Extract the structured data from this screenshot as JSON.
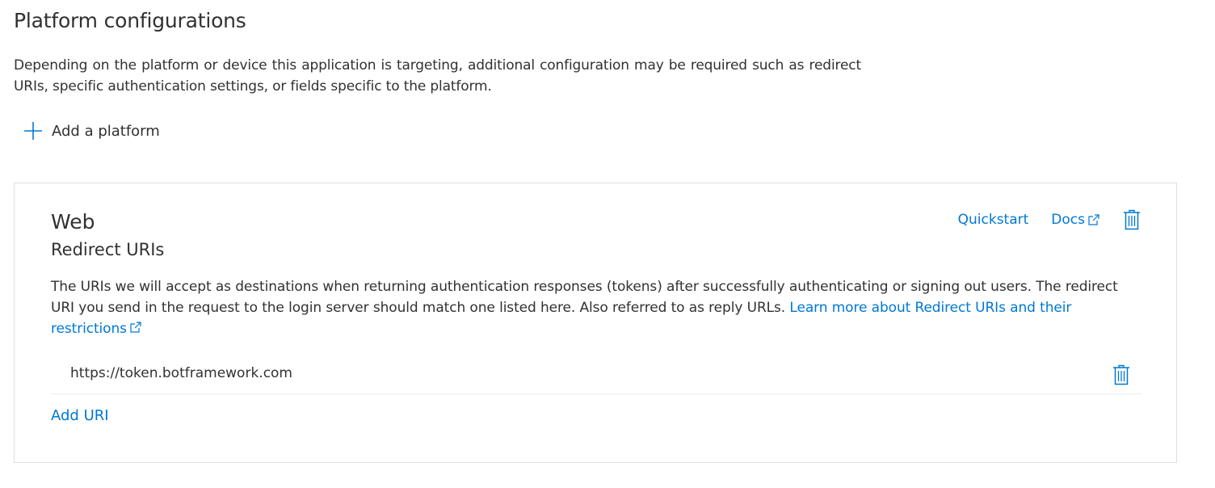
{
  "section": {
    "title": "Platform configurations",
    "description": "Depending on the platform or device this application is targeting, additional configuration may be required such as redirect URIs, specific authentication settings, or fields specific to the platform.",
    "add_platform_label": "Add a platform"
  },
  "card": {
    "title": "Web",
    "subtitle": "Redirect URIs",
    "actions": {
      "quickstart_label": "Quickstart",
      "docs_label": "Docs"
    },
    "description": "The URIs we will accept as destinations when returning authentication responses (tokens) after successfully authenticating or signing out users. The redirect URI you send in the request to the login server should match one listed here. Also referred to as reply URLs. ",
    "learn_more_label": "Learn more about Redirect URIs and their restrictions",
    "redirect_uris": [
      "https://token.botframework.com"
    ],
    "add_uri_label": "Add URI"
  },
  "icons": {
    "add": "plus-icon",
    "external_link": "external-link-icon",
    "delete": "trash-icon"
  },
  "colors": {
    "accent": "#0078d4",
    "text": "#323130",
    "border": "#e1dfdd"
  }
}
